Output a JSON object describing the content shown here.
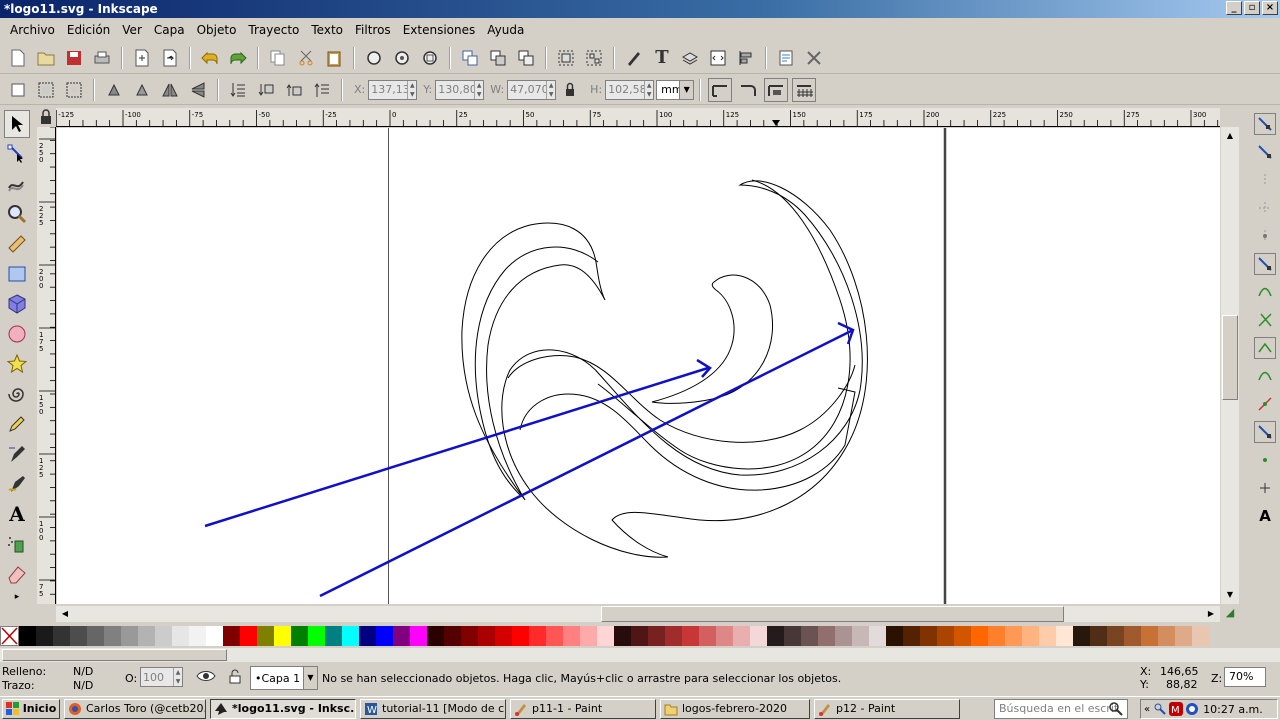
{
  "window": {
    "title": "*logo11.svg - Inkscape",
    "btn_min": "_",
    "btn_max": "▫",
    "btn_close": "×"
  },
  "menu": [
    "Archivo",
    "Edición",
    "Ver",
    "Capa",
    "Objeto",
    "Trayecto",
    "Texto",
    "Filtros",
    "Extensiones",
    "Ayuda"
  ],
  "controls": {
    "x_label": "X:",
    "x_value": "137,137",
    "y_label": "Y:",
    "y_value": "130,808",
    "w_label": "W:",
    "w_value": "47,070",
    "h_label": "H:",
    "h_value": "102,580",
    "unit": "mm"
  },
  "ruler": {
    "h_labels": [
      "-125",
      "-100",
      "-75",
      "-50",
      "-25",
      "0",
      "25",
      "50",
      "75",
      "100",
      "125",
      "150",
      "175",
      "200",
      "225",
      "250",
      "275",
      "300"
    ],
    "v_labels": [
      "250",
      "225",
      "200",
      "175",
      "150",
      "125",
      "100",
      "75"
    ]
  },
  "status": {
    "fill_label": "Relleno:",
    "fill_value": "N/D",
    "stroke_label": "Trazo:",
    "stroke_value": "N/D",
    "opacity_label": "O:",
    "opacity_value": "100",
    "layer": "•Capa 1",
    "message": "No se han seleccionado objetos. Haga clic, Mayús+clic o arrastre para seleccionar los objetos.",
    "cursor_x_label": "X:",
    "cursor_x": "146,65",
    "cursor_y_label": "Y:",
    "cursor_y": "88,82",
    "zoom_label": "Z:",
    "zoom": "70%"
  },
  "palette": [
    "#000000",
    "#1a1a1a",
    "#333333",
    "#4d4d4d",
    "#666666",
    "#808080",
    "#999999",
    "#b3b3b3",
    "#cccccc",
    "#e6e6e6",
    "#f2f2f2",
    "#ffffff",
    "#800000",
    "#ff0000",
    "#808000",
    "#ffff00",
    "#008000",
    "#00ff00",
    "#008080",
    "#00ffff",
    "#000080",
    "#0000ff",
    "#800080",
    "#ff00ff",
    "#2b0000",
    "#550000",
    "#800000",
    "#aa0000",
    "#d40000",
    "#ff0000",
    "#ff2a2a",
    "#ff5555",
    "#ff8080",
    "#ffaaaa",
    "#ffd5d5",
    "#280b0b",
    "#501616",
    "#782121",
    "#a02c2c",
    "#c83737",
    "#d35f5f",
    "#de8787",
    "#e9afaf",
    "#f4d7d7",
    "#241c1c",
    "#483737",
    "#6c5353",
    "#916f6f",
    "#ac9393",
    "#c8b7b7",
    "#e3dbdb",
    "#2b1100",
    "#552200",
    "#803300",
    "#aa4400",
    "#d45500",
    "#ff6600",
    "#ff7f2a",
    "#ff9955",
    "#ffb380",
    "#ffccaa",
    "#ffe6d5",
    "#28170b",
    "#502d16",
    "#784421",
    "#a05a2c",
    "#c87137",
    "#d38d5f",
    "#deaa87",
    "#e9c6af"
  ],
  "taskbar": {
    "start": "Inicio",
    "tasks": [
      "Carlos Toro (@cetb20...",
      "*logo11.svg - Inksc...",
      "tutorial-11 [Modo de c...",
      "p11-1 - Paint",
      "logos-febrero-2020",
      "p12 - Paint"
    ],
    "search_placeholder": "Búsqueda en el escrit",
    "clock": "10:27 a.m."
  }
}
